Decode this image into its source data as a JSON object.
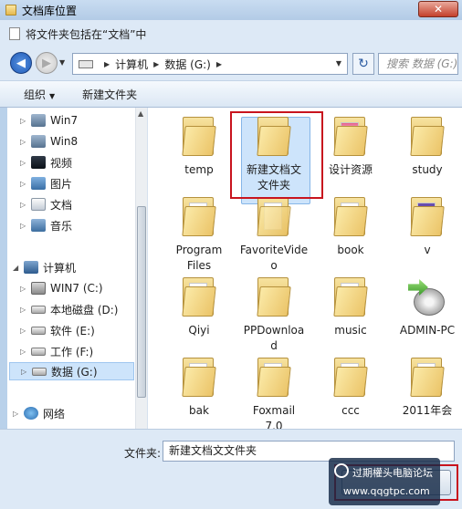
{
  "window": {
    "title": "文档库位置",
    "close_glyph": "✕"
  },
  "dialog": {
    "heading": "将文件夹包括在“文档”中"
  },
  "address": {
    "crumbs": [
      "计算机",
      "数据 (G:)"
    ],
    "search_placeholder": "搜索 数据 (G:)"
  },
  "toolbar": {
    "organize": "组织",
    "new_folder": "新建文件夹"
  },
  "nav": {
    "items": [
      {
        "label": "Win7",
        "icon": "library-icon"
      },
      {
        "label": "Win8",
        "icon": "library-icon"
      },
      {
        "label": "视频",
        "icon": "video-library-icon"
      },
      {
        "label": "图片",
        "icon": "pictures-library-icon"
      },
      {
        "label": "文档",
        "icon": "documents-library-icon"
      },
      {
        "label": "音乐",
        "icon": "music-library-icon"
      },
      {
        "label": "计算机",
        "icon": "computer-icon"
      },
      {
        "label": "WIN7 (C:)",
        "icon": "windows-drive-icon"
      },
      {
        "label": "本地磁盘 (D:)",
        "icon": "drive-icon"
      },
      {
        "label": "软件 (E:)",
        "icon": "drive-icon"
      },
      {
        "label": "工作 (F:)",
        "icon": "drive-icon"
      },
      {
        "label": "数据 (G:)",
        "icon": "drive-icon"
      },
      {
        "label": "网络",
        "icon": "network-icon"
      }
    ]
  },
  "files": [
    {
      "label": "temp"
    },
    {
      "label": "新建文档文文件夹"
    },
    {
      "label": "设计资源"
    },
    {
      "label": "study"
    },
    {
      "label": "Program Files"
    },
    {
      "label": "FavoriteVideo"
    },
    {
      "label": "book"
    },
    {
      "label": "v"
    },
    {
      "label": "Qiyi"
    },
    {
      "label": "PPDownload"
    },
    {
      "label": "music"
    },
    {
      "label": "ADMIN-PC"
    },
    {
      "label": "bak"
    },
    {
      "label": "Foxmail 7.0"
    },
    {
      "label": "ccc"
    },
    {
      "label": "2011年会"
    }
  ],
  "bottom": {
    "filename_label": "文件夹:",
    "filename_value": "新建文档文文件夹"
  },
  "watermark": {
    "line1": "过期權头电脑论坛",
    "line2": "www.qqgtpc.com"
  }
}
